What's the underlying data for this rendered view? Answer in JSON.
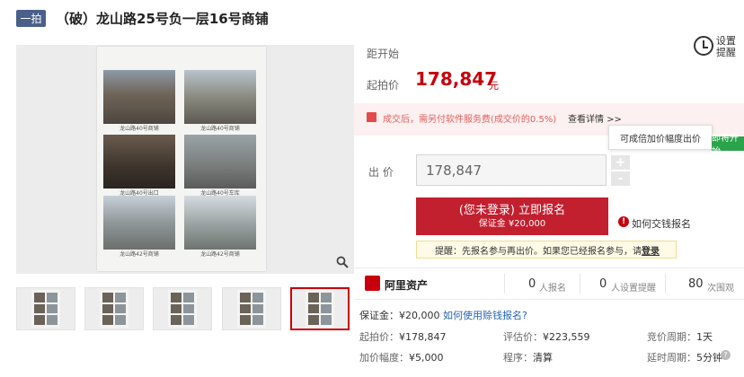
{
  "header": {
    "round_badge": "一拍",
    "title": "（破）龙山路25号负一层16号商铺"
  },
  "gallery": {
    "captions": [
      "龙山路40号商铺",
      "龙山路40号商铺",
      "龙山路40号出口",
      "龙山路40号车库",
      "龙山路42号商铺",
      "龙山路42号商铺"
    ],
    "thumbnail_count": 5,
    "active_thumbnail": 5
  },
  "auction": {
    "countdown_label": "距开始",
    "remind_label": "设置提醒",
    "start_price_label": "起拍价",
    "start_price": "178,847",
    "start_price_unit": "元",
    "notice_text": "成交后，需另付软件服务费(成交价的0.5%)",
    "notice_link": "查看详情 >>",
    "tooltip": "可成倍加价幅度出价",
    "status_badge": "即将开始",
    "bid_label": "出  价",
    "bid_value": "178,847",
    "plus": "+",
    "minus": "-",
    "signup_main": "(您未登录) 立即报名",
    "signup_sub": "保证金 ¥20,000",
    "deposit_howto": "如何交钱报名",
    "hint_prefix": "提醒：先报名参与再出价。如果您已经报名参与，请",
    "hint_link": "登录"
  },
  "stats": {
    "platform": "阿里资产",
    "signups_num": "0",
    "signups_label": "人报名",
    "reminders_num": "0",
    "reminders_label": "人设置提醒",
    "views_num": "80",
    "views_label": "次围观"
  },
  "details": {
    "deposit": "保证金：¥20,000",
    "deposit_link": "如何使用赊钱报名?",
    "start_price_k": "起拍价：",
    "start_price_v": "¥178,847",
    "appraisal_k": "评估价：",
    "appraisal_v": "¥223,559",
    "cycle_k": "竞价周期：",
    "cycle_v": "1天",
    "increment_k": "加价幅度：",
    "increment_v": "¥5,000",
    "procedure_k": "程序：",
    "procedure_v": "清算",
    "delay_k": "延时周期：",
    "delay_v": "5分钟"
  }
}
